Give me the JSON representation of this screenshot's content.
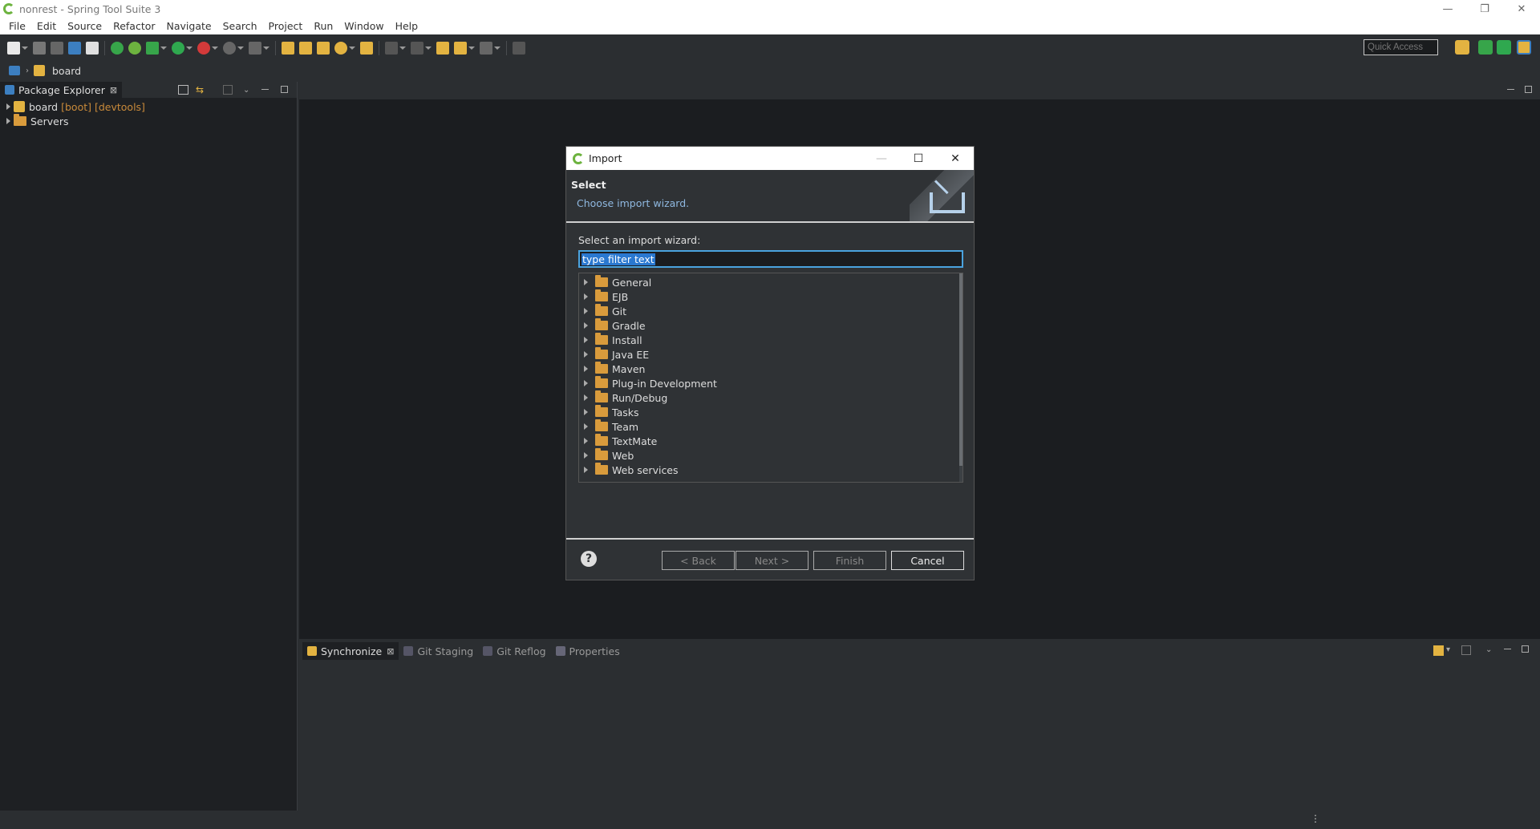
{
  "window": {
    "title": "nonrest - Spring Tool Suite 3",
    "minimize": "—",
    "restore": "❐",
    "close": "✕"
  },
  "menu": [
    "File",
    "Edit",
    "Source",
    "Refactor",
    "Navigate",
    "Search",
    "Project",
    "Run",
    "Window",
    "Help"
  ],
  "toolbar": {
    "quick_access_placeholder": "Quick Access"
  },
  "breadcrumb": {
    "item": "board"
  },
  "package_explorer": {
    "tab_label": "Package Explorer",
    "close": "⊠",
    "items": [
      {
        "name": "board",
        "decoration": "[boot] [devtools]"
      },
      {
        "name": "Servers",
        "decoration": ""
      }
    ]
  },
  "bottom_panel": {
    "tabs": [
      {
        "label": "Synchronize",
        "active": true
      },
      {
        "label": "Git Staging",
        "active": false
      },
      {
        "label": "Git Reflog",
        "active": false
      },
      {
        "label": "Properties",
        "active": false
      }
    ],
    "close": "⊠"
  },
  "dialog": {
    "title": "Import",
    "minimize": "—",
    "maximize": "☐",
    "close": "✕",
    "header_title": "Select",
    "header_desc": "Choose import wizard.",
    "select_label": "Select an import wizard:",
    "filter_value": "type filter text",
    "wizards": [
      "General",
      "EJB",
      "Git",
      "Gradle",
      "Install",
      "Java EE",
      "Maven",
      "Plug-in Development",
      "Run/Debug",
      "Tasks",
      "Team",
      "TextMate",
      "Web",
      "Web services"
    ],
    "buttons": {
      "back": "< Back",
      "next": "Next >",
      "finish": "Finish",
      "cancel": "Cancel"
    },
    "help": "?"
  },
  "colors": {
    "accent_blue": "#4aa3df",
    "spring_green": "#6db33f",
    "folder": "#d99b3c"
  }
}
